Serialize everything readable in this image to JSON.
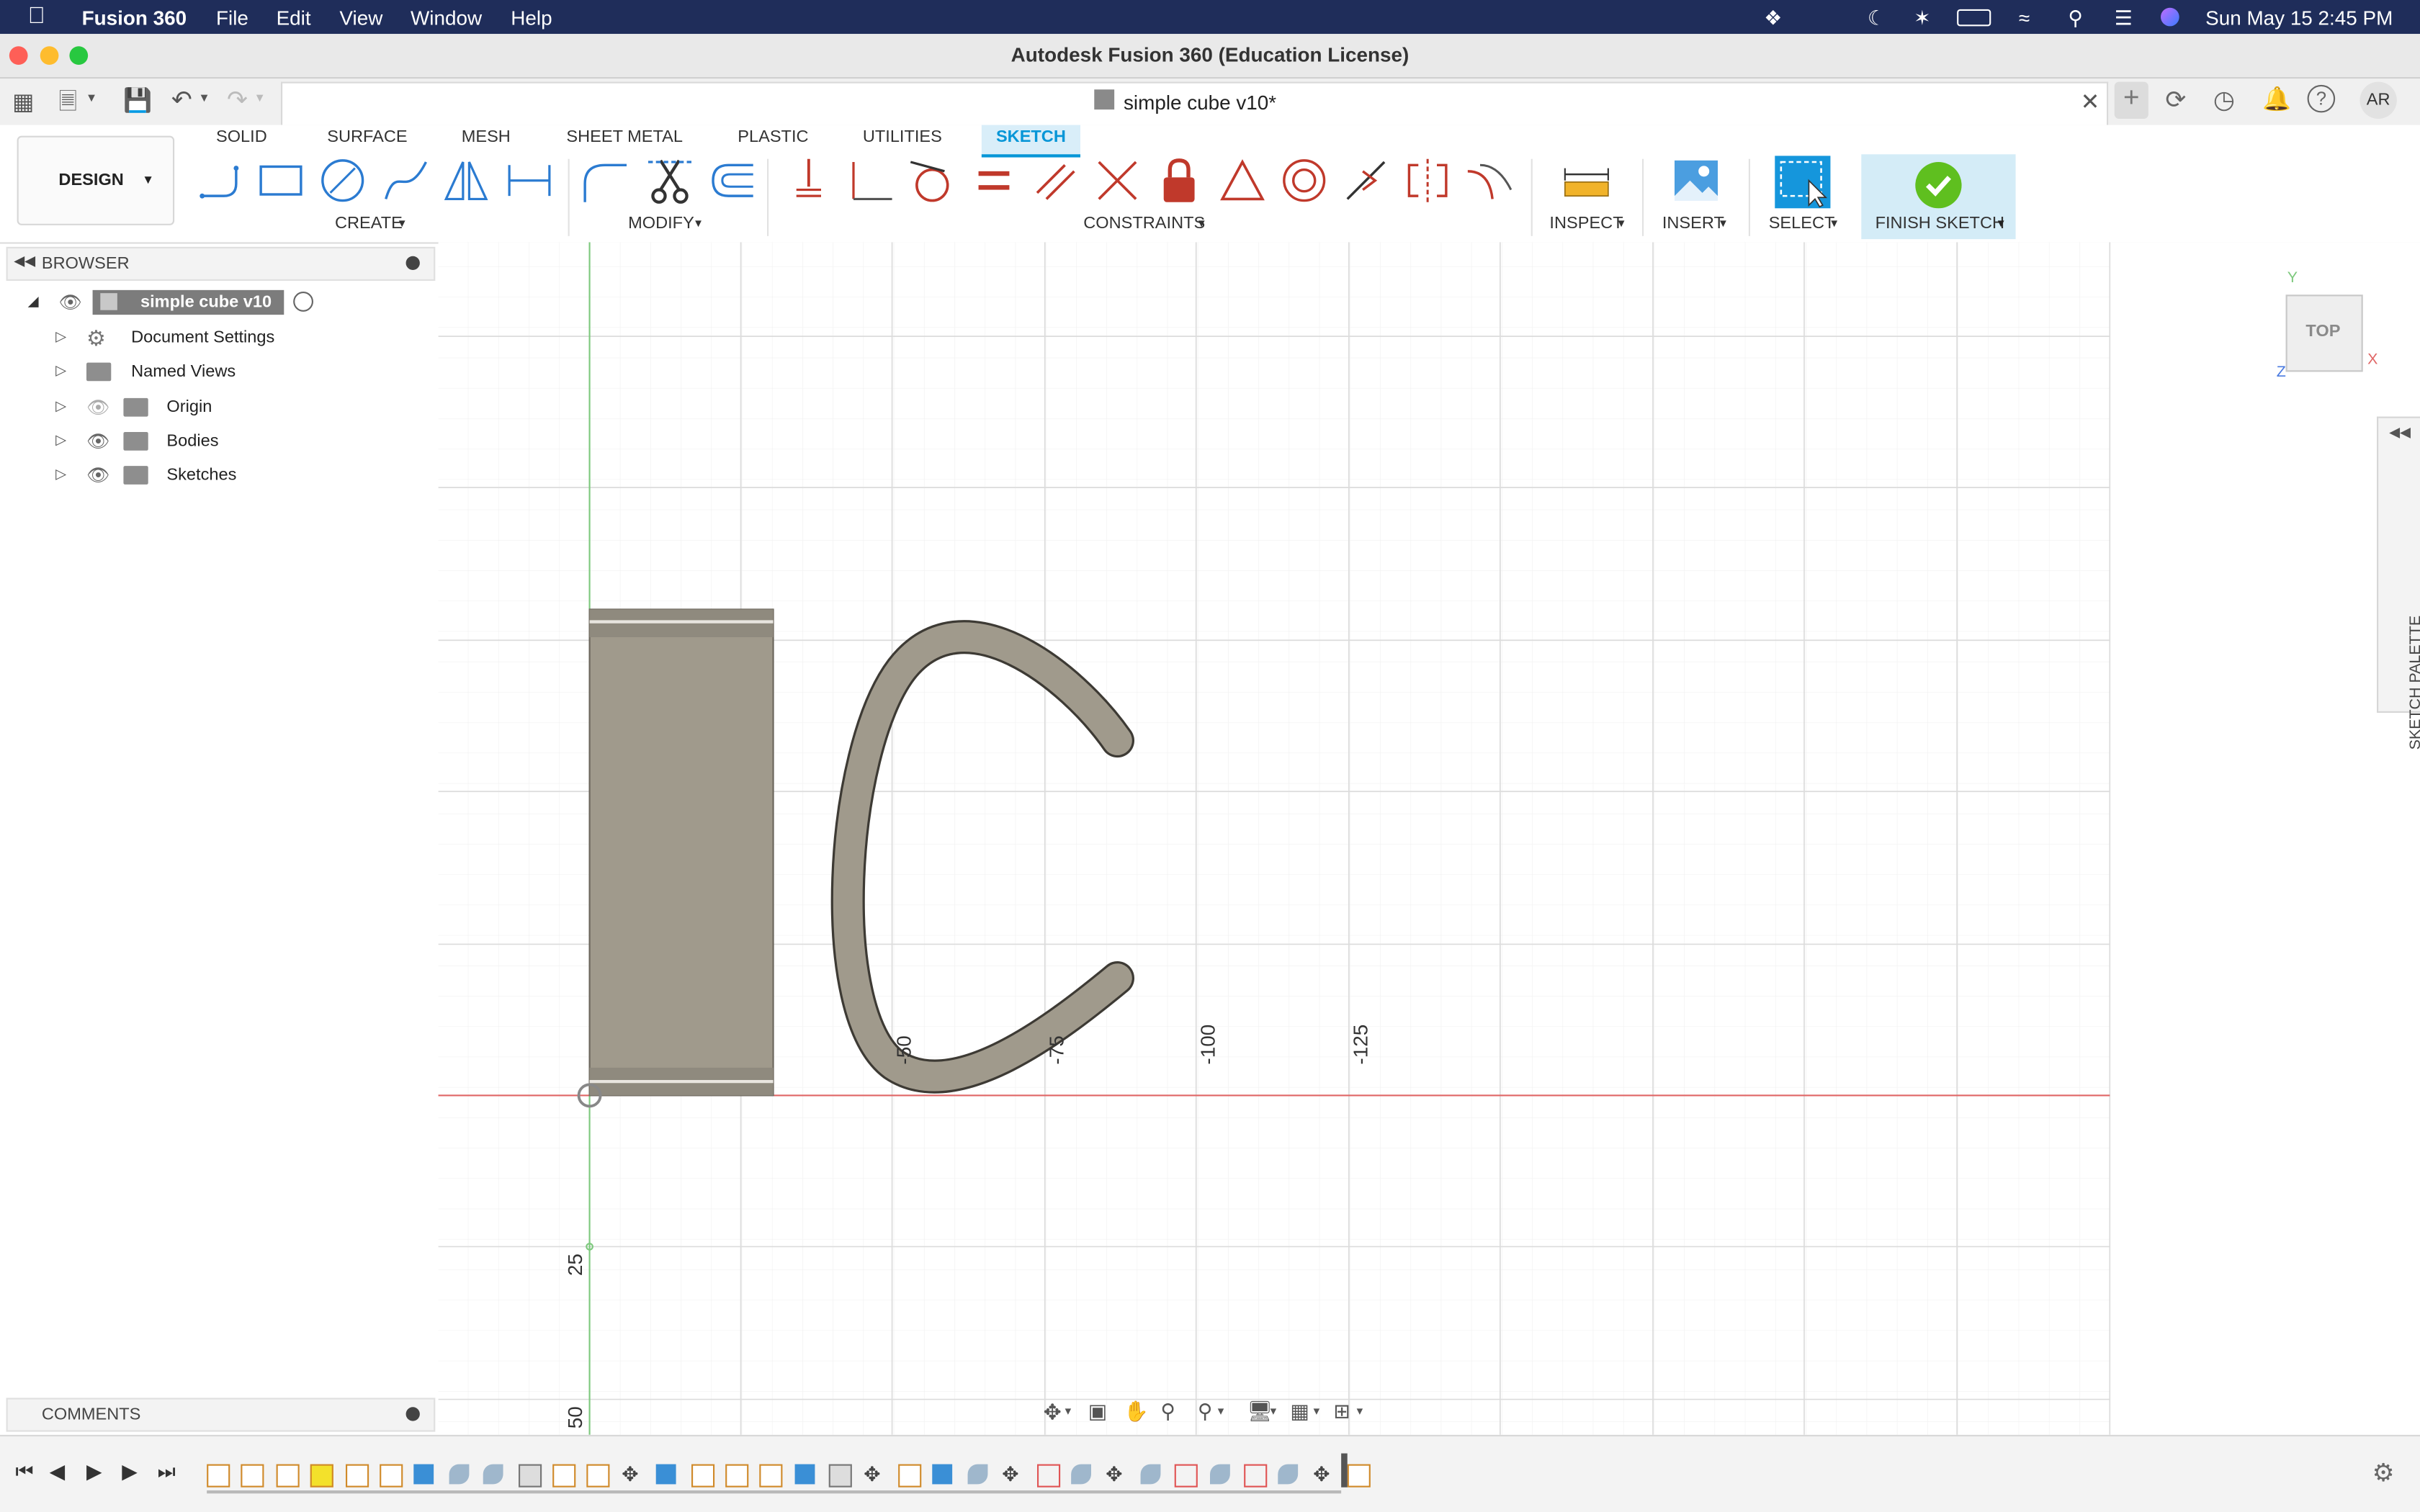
{
  "menubar": {
    "app_name": "Fusion 360",
    "items": [
      "File",
      "Edit",
      "View",
      "Window",
      "Help"
    ],
    "datetime": "Sun May 15  2:45 PM"
  },
  "window": {
    "title": "Autodesk Fusion 360 (Education License)"
  },
  "document_tab": {
    "title": "simple cube v10*"
  },
  "user": {
    "initials": "AR"
  },
  "ribbon": {
    "workspace": "DESIGN",
    "tabs": [
      "SOLID",
      "SURFACE",
      "MESH",
      "SHEET METAL",
      "PLASTIC",
      "UTILITIES",
      "SKETCH"
    ],
    "active_tab": "SKETCH",
    "groups": {
      "create": "CREATE",
      "modify": "MODIFY",
      "constraints": "CONSTRAINTS",
      "inspect": "INSPECT",
      "insert": "INSERT",
      "select": "SELECT",
      "finish": "FINISH SKETCH"
    }
  },
  "browser": {
    "header": "BROWSER",
    "root": "simple cube v10",
    "items": [
      "Document Settings",
      "Named Views",
      "Origin",
      "Bodies",
      "Sketches"
    ]
  },
  "comments": {
    "header": "COMMENTS"
  },
  "viewcube": {
    "face": "TOP",
    "axis_x": "X",
    "axis_y": "Y",
    "axis_z": "Z"
  },
  "sketch_palette": {
    "label": "SKETCH PALETTE"
  },
  "rulers": {
    "x_labels": [
      "-50",
      "-75",
      "-100",
      "-125"
    ],
    "y_labels": [
      "25",
      "50"
    ]
  },
  "colors": {
    "menubar_bg": "#1f2d5a",
    "sketch_tab_accent": "#0696d7",
    "finish_green": "#5fbf1f",
    "body_fill": "#a09a8c",
    "axis_red": "#e06666",
    "axis_green": "#7ec97e"
  }
}
